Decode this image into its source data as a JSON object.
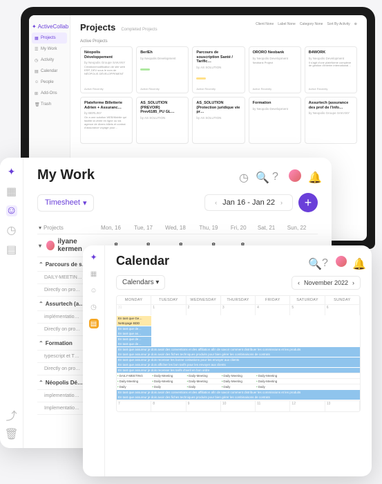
{
  "projects_window": {
    "app_name": "ActiveCollab",
    "nav": [
      "Projects",
      "My Work",
      "Activity",
      "Calendar",
      "People",
      "Add-Ons",
      "Trash"
    ],
    "active_nav": 0,
    "title": "Projects",
    "subtitle": "Completed Projects",
    "filters": {
      "client": "Client None",
      "label": "Label None",
      "category": "Category None",
      "sort": "Sort By Activity"
    },
    "section": "Active Projects",
    "cards": [
      {
        "title": "Néopolis Développement",
        "owner": "by Neopolis Groupe SAKANY",
        "desc": "Création/modification de site web ERP, DEV sous le nom de NÉOPOLIS DÉVELOPPEMENT",
        "status": "Active Recently"
      },
      {
        "title": "BerlEh",
        "owner": "by Neopolis Development",
        "desc": "",
        "status": "Active Recently",
        "badge": "#aee8a0"
      },
      {
        "title": "Parcours de souscription Santé / Tarific…",
        "owner": "by AS SOLUTION",
        "desc": "",
        "status": "Active Recently",
        "badge": "#ffe08a"
      },
      {
        "title": "ORORO Neobank",
        "owner": "by Neopolis Development",
        "desc": "Neobank Project",
        "status": "Active Recently"
      },
      {
        "title": "B4WORK",
        "owner": "by Neopolis Development",
        "desc": "Il s'agit d'une plateforme complexe de gestion d'intérim international…",
        "status": "Active Recently"
      },
      {
        "title": "Plateforme Billetterie Adrien + Assuranc…",
        "owner": "by BERLINY",
        "desc": "On a une solution WEB/Mobile qui facilite la vente en ligne ou via agence de divers billets et contrat d'assurance voyage pour…"
      },
      {
        "title": "AS_SOLUTION (PREVOIR) Prev6185_PU GL…",
        "owner": "by AS SOLUTION"
      },
      {
        "title": "AS_SOLUTION (Protection juridique vie pr…",
        "owner": "by AS SOLUTION"
      },
      {
        "title": "Formation",
        "owner": "by Neopolis Development"
      },
      {
        "title": "Assurtech (assurance des prof de l'info…",
        "owner": "by Neopolis Groupe SAKANY"
      }
    ]
  },
  "mywork_window": {
    "title": "My Work",
    "tab": "Timesheet",
    "date_range": "Jan 16 - Jan 22",
    "columns": [
      "Projects",
      "Mon, 16",
      "Tue, 17",
      "Wed, 18",
      "Thu, 19",
      "Fri, 20",
      "Sat, 21",
      "Sun, 22"
    ],
    "user": {
      "name": "ilyane kermen",
      "totals": [
        "8",
        "8",
        "8",
        "8",
        "8",
        "",
        ""
      ]
    },
    "groups": [
      {
        "name": "Parcours de s…",
        "rows": [
          {
            "task": "DAILY-MEETIN…"
          },
          {
            "task": "Directly on pro…"
          }
        ]
      },
      {
        "name": "Assurtech (a…",
        "rows": [
          {
            "task": "implémentatio…"
          },
          {
            "task": "Directly on pro…"
          }
        ]
      },
      {
        "name": "Formation",
        "rows": [
          {
            "task": "typescript et T…"
          },
          {
            "task": "Directly on pro…"
          }
        ]
      },
      {
        "name": "Néopolis Dé…",
        "rows": [
          {
            "task": "implementatio…"
          },
          {
            "task": "Implementatio…"
          }
        ]
      }
    ]
  },
  "calendar_window": {
    "title": "Calendar",
    "dropdown": "Calendars",
    "month": "November 2022",
    "day_headers": [
      "MONDAY",
      "TUESDAY",
      "WEDNESDAY",
      "THURSDAY",
      "FRIDAY",
      "SATURDAY",
      "SUNDAY"
    ],
    "first_row_dates": [
      "31",
      "1",
      "2",
      "3",
      "4",
      "5",
      "6"
    ],
    "later_dates": [
      "7",
      "8",
      "9",
      "10",
      "11",
      "12",
      "13"
    ],
    "events_short": [
      "En tant que Ge…",
      "Nettoyage BDD",
      "En tant que de…",
      "En tant que as…",
      "En tant que de…",
      "En tant que de…"
    ],
    "events_long": [
      "En tant que assureur je dois avoir des conventions et des affiliation afin de savoir comment distribuer les commissions et les produits",
      "En tant que assureur je dois avoir des fiches techniques produits pour bien gérer les combinaisons de contrats",
      "En tant que assureur je dois recenser les bonne cotisations pour les envoyer aux clients",
      "En tant que assureur je dois afficher les bon tarifs pour les envoyer aux clients",
      "En tant que assureur je dois recenser les tarifs d'avril en bon ordre"
    ],
    "daily_labels": [
      "DAILY-MEETING",
      "Daily-Meeting",
      "Daily-Meeting",
      "Daily-Meeting",
      "Daily-Meeting",
      "Daily-Meeting",
      "Daily-Meeting",
      "Daily-Meeting",
      "Daily-Meeting",
      "Daily-Meeting",
      "Daily",
      "Daily",
      "Daily",
      "Daily",
      "Daily"
    ],
    "footer_events": [
      "En tant que assureur je dois avoir des conventions et des affiliation afin de savoir comment distribuer les commissions et les produits",
      "En tant que assureur je dois avoir des fiches techniques produits pour bien gérer les combinaisons de contrats"
    ]
  }
}
